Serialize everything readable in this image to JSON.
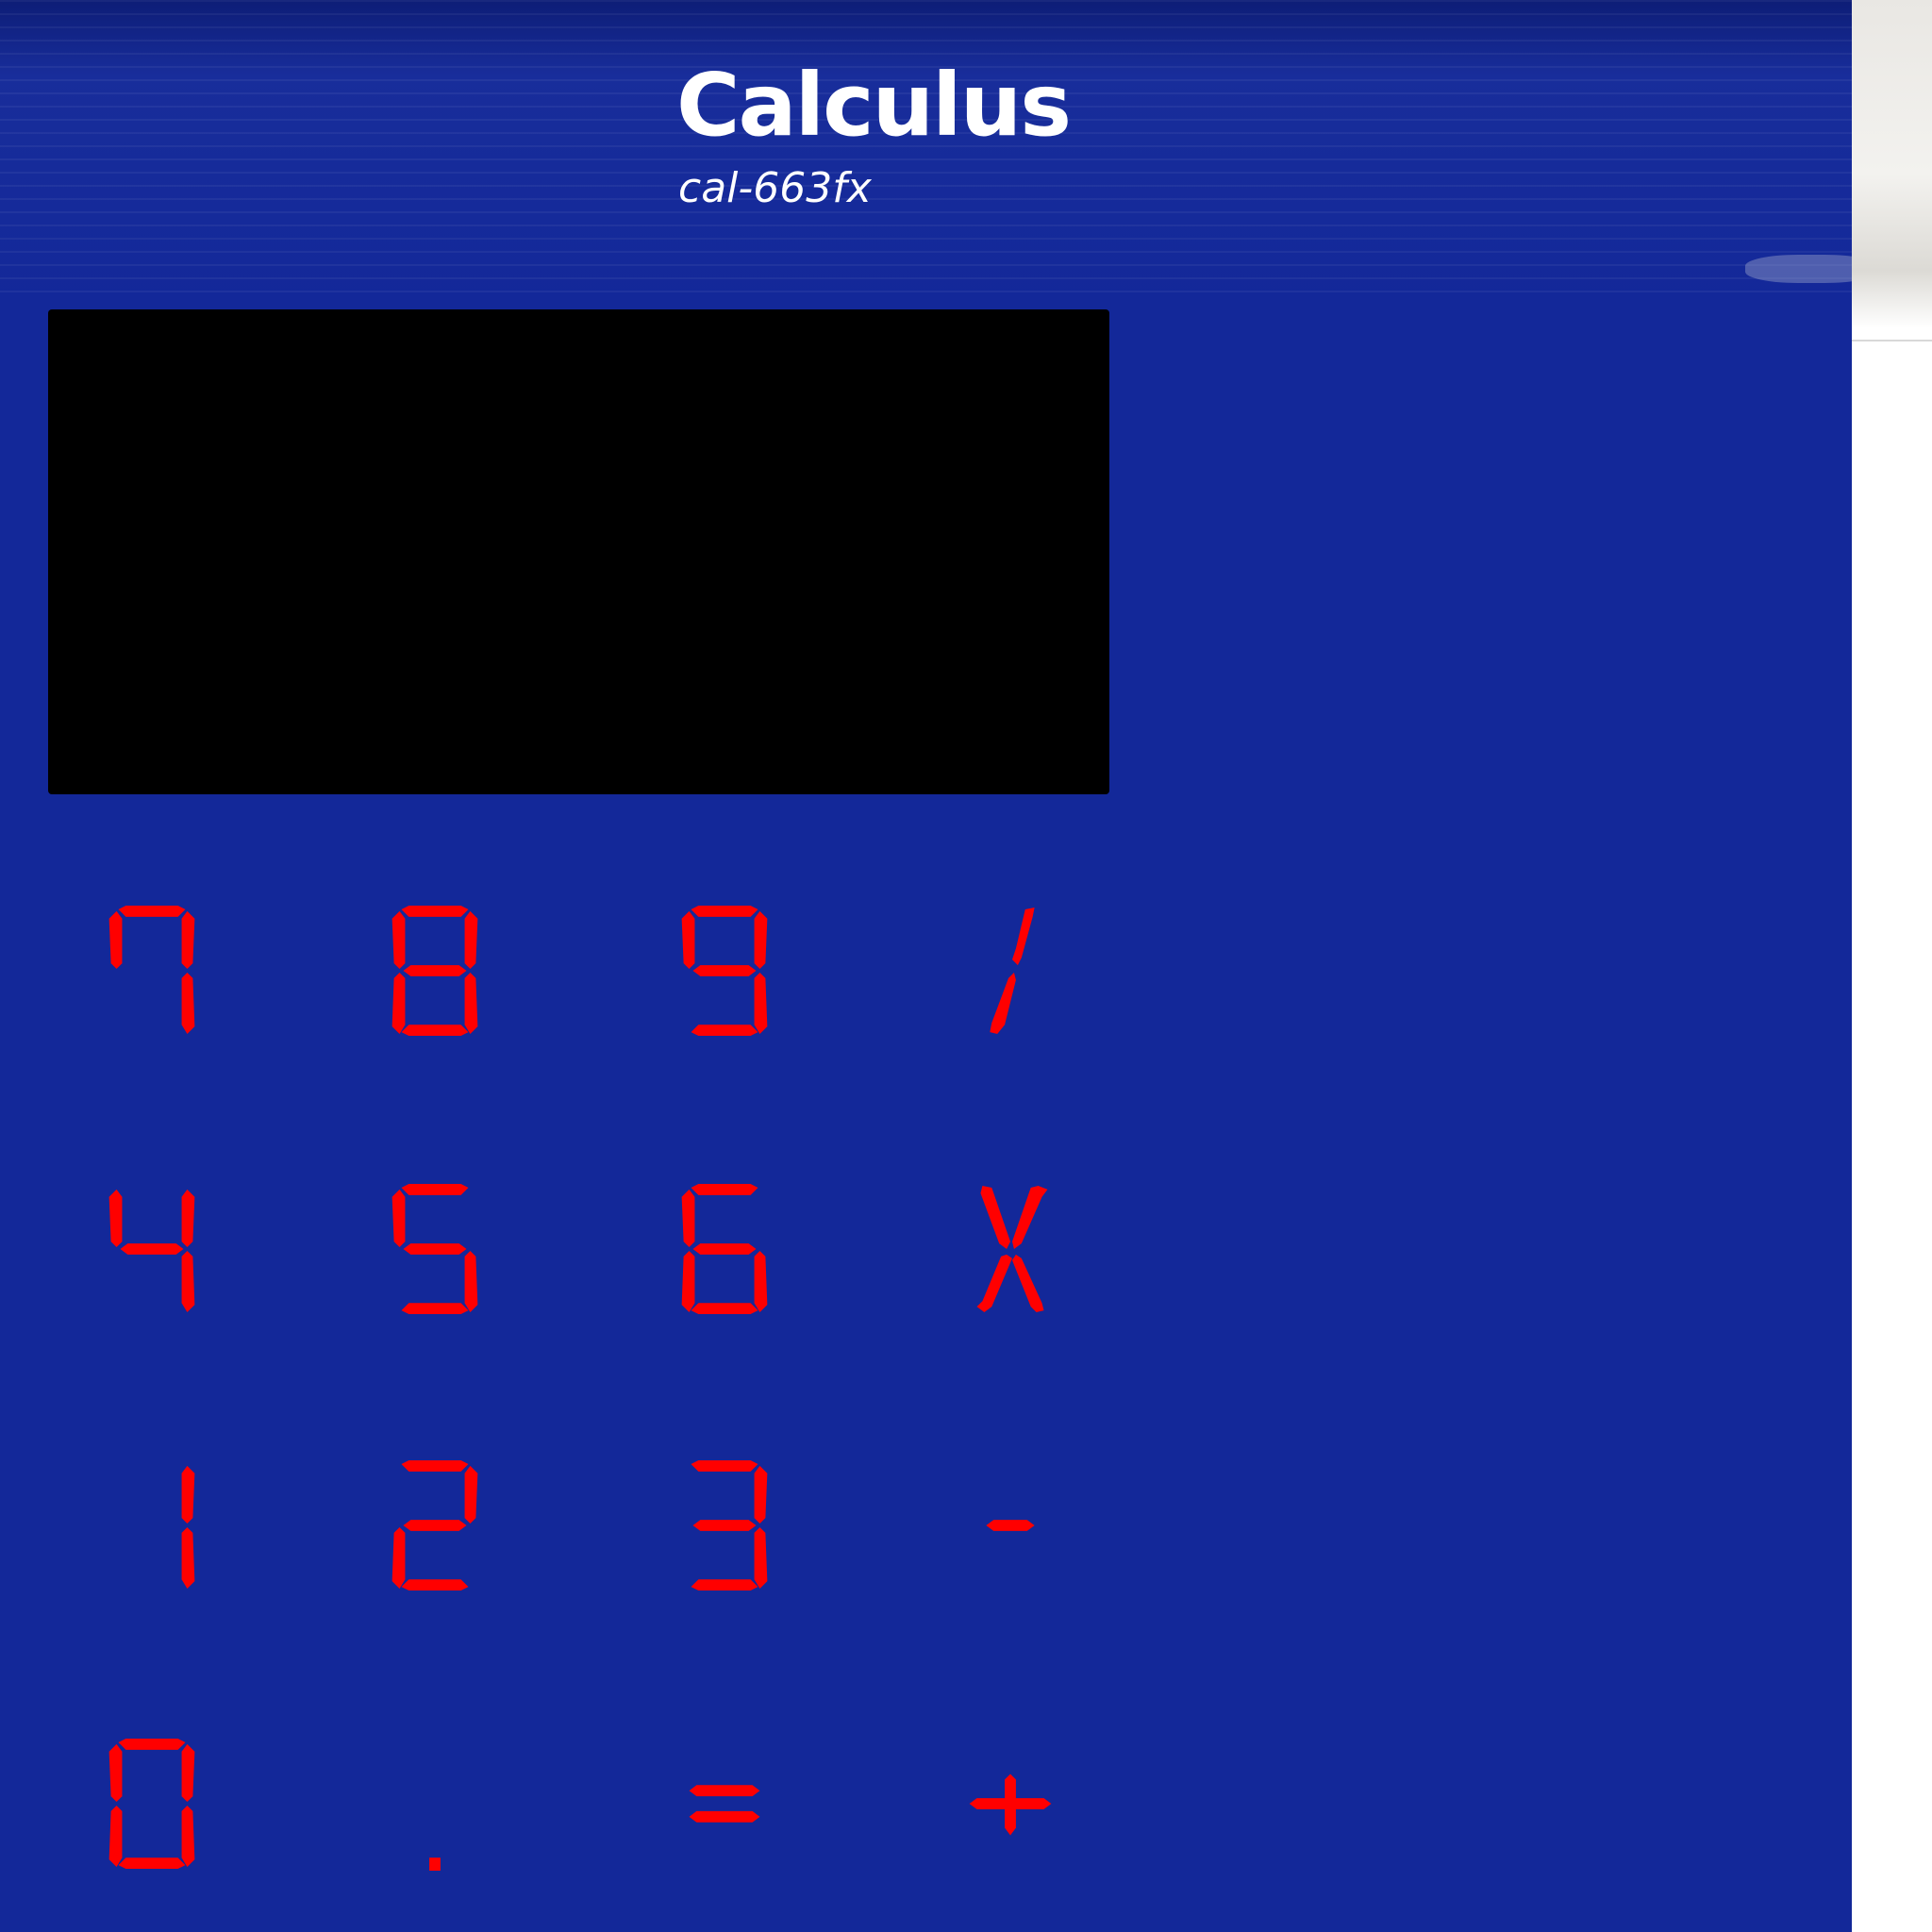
{
  "app": {
    "title": "Calculus",
    "model": "cal-663fx"
  },
  "display": {
    "value": ""
  },
  "colors": {
    "panel": "#132899",
    "display_bg": "#000000",
    "key_text": "#ff0000",
    "title_text": "#ffffff"
  },
  "keypad": {
    "keys": [
      {
        "label": "7",
        "name": "key-7"
      },
      {
        "label": "8",
        "name": "key-8"
      },
      {
        "label": "9",
        "name": "key-9"
      },
      {
        "label": "/",
        "name": "key-divide"
      },
      {
        "label": "4",
        "name": "key-4"
      },
      {
        "label": "5",
        "name": "key-5"
      },
      {
        "label": "6",
        "name": "key-6"
      },
      {
        "label": "X",
        "name": "key-multiply"
      },
      {
        "label": "1",
        "name": "key-1"
      },
      {
        "label": "2",
        "name": "key-2"
      },
      {
        "label": "3",
        "name": "key-3"
      },
      {
        "label": "-",
        "name": "key-subtract"
      },
      {
        "label": "0",
        "name": "key-0"
      },
      {
        "label": ".",
        "name": "key-decimal"
      },
      {
        "label": "=",
        "name": "key-equals"
      },
      {
        "label": "+",
        "name": "key-add"
      }
    ]
  }
}
